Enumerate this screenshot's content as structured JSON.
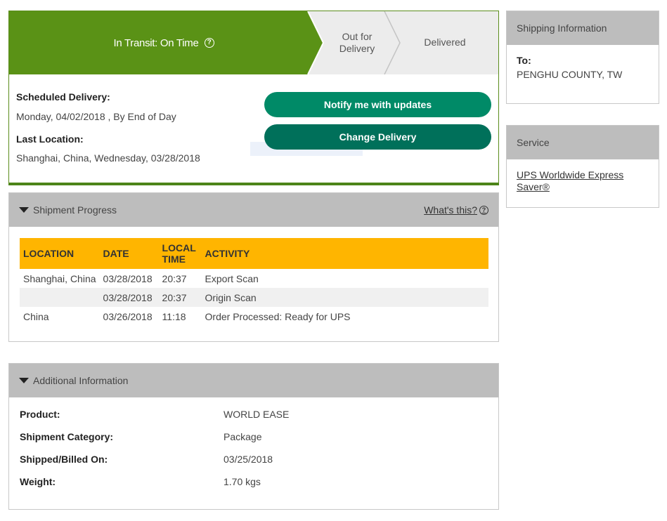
{
  "status": {
    "steps": {
      "current": "In Transit: On Time",
      "out_for_delivery": "Out for Delivery",
      "delivered": "Delivered"
    },
    "help_glyph": "?",
    "scheduled_label": "Scheduled Delivery:",
    "scheduled_value": "Monday, 04/02/2018 , By End of Day",
    "last_location_label": "Last Location:",
    "last_location_value": "Shanghai, China, Wednesday, 03/28/2018",
    "notify_button": "Notify me with updates",
    "change_button": "Change Delivery",
    "colors": {
      "current": "#5a9216",
      "inactive": "#ececec",
      "accent_button": "#008a67"
    }
  },
  "shipment_progress": {
    "title": "Shipment Progress",
    "whats_this": "What's this?",
    "columns": [
      "LOCATION",
      "DATE",
      "LOCAL TIME",
      "ACTIVITY"
    ],
    "rows": [
      {
        "location": "Shanghai,  China",
        "date": "03/28/2018",
        "time": "20:37",
        "activity": "Export Scan"
      },
      {
        "location": "",
        "date": "03/28/2018",
        "time": "20:37",
        "activity": "Origin Scan"
      },
      {
        "location": "China",
        "date": "03/26/2018",
        "time": "11:18",
        "activity": "Order Processed: Ready for UPS"
      }
    ],
    "header_color": "#ffb500"
  },
  "additional_info": {
    "title": "Additional Information",
    "fields": [
      {
        "key": "Product:",
        "value": "WORLD EASE"
      },
      {
        "key": "Shipment Category:",
        "value": "Package"
      },
      {
        "key": "Shipped/Billed On:",
        "value": "03/25/2018"
      },
      {
        "key": "Weight:",
        "value": "1.70 kgs"
      }
    ]
  },
  "shipping_information": {
    "title": "Shipping Information",
    "to_label": "To:",
    "to_value": "PENGHU COUNTY,  TW"
  },
  "service": {
    "title": "Service",
    "value": "UPS Worldwide Express Saver®"
  }
}
